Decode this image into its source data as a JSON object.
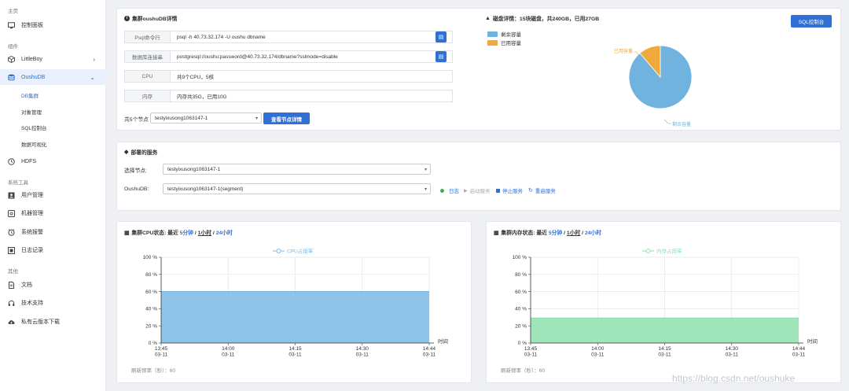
{
  "sidebar": {
    "section_main": "主页",
    "dashboard": "控制面板",
    "section_components": "组件",
    "littleboy": "LittleBoy",
    "oushudb": "OushuDB",
    "sub_items": [
      "DB集群",
      "对象管理",
      "SQL控制台",
      "数据可视化"
    ],
    "hdfs": "HDFS",
    "section_tools": "系统工具",
    "tools": [
      "用户管理",
      "机器管理",
      "系统报警",
      "日志记录"
    ],
    "section_other": "其他",
    "other": [
      "文档",
      "技术支持",
      "私有云版本下载"
    ]
  },
  "detail": {
    "title": "集群oushuDB详情",
    "rows": [
      {
        "label": "Psql命令行",
        "value": "psql -h 40.73.32.174 -U oushu dbname"
      },
      {
        "label": "数据库连接串",
        "value": "postgresql://oushu:password@40.73.32.174/dbname?sslmode=disable"
      },
      {
        "label": "CPU",
        "value": "共9个CPU，5核"
      },
      {
        "label": "内存",
        "value": "内存共35G，已用10G"
      }
    ],
    "nodes_label": "共5个节点",
    "node_select": "testyixusong1063147-1",
    "view_button": "查看节点详情"
  },
  "disk": {
    "title": "磁盘详情：15块磁盘，共240GB，已用27GB",
    "sql_button": "SQL控制台",
    "legend": [
      {
        "name": "剩余容量",
        "color": "#6fb3de"
      },
      {
        "name": "已用容量",
        "color": "#f0a93b"
      }
    ],
    "label_used": "已用容量",
    "label_free": "剩余容量"
  },
  "chart_data": [
    {
      "type": "pie",
      "categories": [
        "剩余容量",
        "已用容量"
      ],
      "values": [
        213,
        27
      ]
    },
    {
      "type": "area",
      "series": [
        {
          "name": "CPU占用率",
          "values": [
            60,
            60,
            60,
            60,
            60
          ]
        }
      ],
      "x": [
        "13:45\n03-11",
        "14:00\n03-11",
        "14:15\n03-11",
        "14:30\n03-11",
        "14:44\n03-11"
      ],
      "xlabel": "时间",
      "ylim": [
        0,
        100
      ],
      "yticks": [
        "0 %",
        "20 %",
        "40 %",
        "60 %",
        "80 %",
        "100 %"
      ],
      "color": "#7ab8e6"
    },
    {
      "type": "area",
      "series": [
        {
          "name": "内存占用率",
          "values": [
            29,
            29,
            29,
            29,
            29
          ]
        }
      ],
      "x": [
        "13:45\n03-11",
        "14:00\n03-11",
        "14:15\n03-11",
        "14:30\n03-11",
        "14:44\n03-11"
      ],
      "xlabel": "时间",
      "ylim": [
        0,
        100
      ],
      "yticks": [
        "0 %",
        "20 %",
        "40 %",
        "60 %",
        "80 %",
        "100 %"
      ],
      "color": "#8ee0ad"
    }
  ],
  "services": {
    "title": "部署的服务",
    "select_node_label": "选择节点:",
    "select_node_value": "testyixusong1063147-1",
    "oushudb_label": "OushuDB:",
    "oushudb_value": "testyixusong1063147-1(segment)",
    "log": "日志",
    "start": "启动服务",
    "stop": "停止服务",
    "restart": "重启服务"
  },
  "cpu_panel": {
    "title": "集群CPU状态: 最近",
    "opt1": "5分钟",
    "opt2": "1小时",
    "opt3": "24小时",
    "sep": "/",
    "refresh": "刷新频率（秒）：60"
  },
  "mem_panel": {
    "title": "集群内存状态: 最近",
    "opt1": "5分钟",
    "opt2": "1小时",
    "opt3": "24小时",
    "sep": "/",
    "refresh": "刷新频率（秒）：60"
  },
  "watermark": "https://blog.csdn.net/oushuke"
}
